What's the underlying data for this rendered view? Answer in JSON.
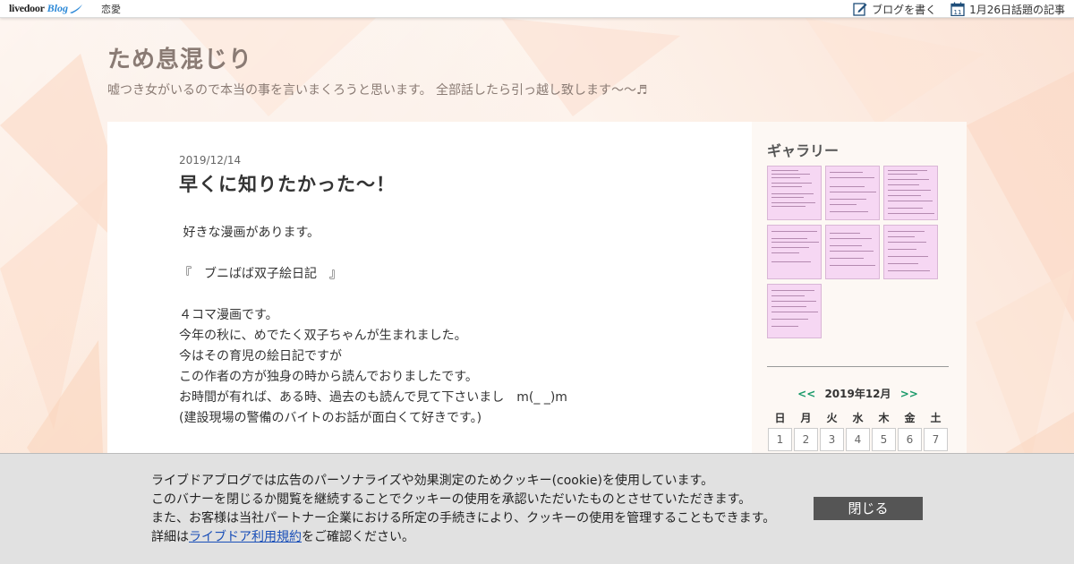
{
  "topbar": {
    "logo_text": "livedoor",
    "logo_blog": "Blog",
    "category": "恋愛",
    "write_label": "ブログを書く",
    "calendar_day": "11",
    "trending_label": "1月26日話題の記事",
    "write_icon": "edit-icon",
    "trending_icon": "calendar-icon"
  },
  "header": {
    "title": "ため息混じり",
    "description": "嘘つき女がいるので本当の事を言いまくろうと思います。 全部話したら引っ越し致します〜〜♬"
  },
  "post": {
    "date": "2019/12/14",
    "title": "早くに知りたかった〜！",
    "lines": [
      " 好きな漫画があります。",
      "",
      "『　ブニばば双子絵日記　』",
      "",
      "４コマ漫画です。",
      "今年の秋に、めでたく双子ちゃんが生まれました。",
      "今はその育児の絵日記ですが",
      "この作者の方が独身の時から読んでおりましたです。",
      "お時間が有れば、ある時、過去のも読んで見て下さいまし　m(_ _)m",
      "(建設現場の警備のバイトのお話が面白くて好きです。)"
    ]
  },
  "sidebar": {
    "gallery_title": "ギャラリー",
    "gallery_count": 7,
    "calendar": {
      "prev": "<<",
      "month": "2019年12月",
      "next": ">>",
      "weekdays": [
        "日",
        "月",
        "火",
        "水",
        "木",
        "金",
        "土"
      ],
      "dates": [
        "1",
        "2",
        "3",
        "4",
        "5",
        "6",
        "7"
      ]
    }
  },
  "cookie": {
    "line1": "ライブドアブログでは広告のパーソナライズや効果測定のためクッキー(cookie)を使用しています。",
    "line2": "このバナーを閉じるか閲覧を継続することでクッキーの使用を承認いただいたものとさせていただきます。",
    "line3": "また、お客様は当社パートナー企業における所定の手続きにより、クッキーの使用を管理することもできます。",
    "line4_prefix": "詳細は",
    "line4_link": "ライブドア利用規約",
    "line4_suffix": "をご確認ください。",
    "close_label": "閉じる"
  },
  "colors": {
    "background": "#fbe9dd",
    "title_text": "#8a7b74",
    "gallery_thumb": "#f6d7f3",
    "calendar_nav": "#1a9a6a",
    "banner_bg": "#e1e1e1",
    "close_button": "#555555"
  }
}
